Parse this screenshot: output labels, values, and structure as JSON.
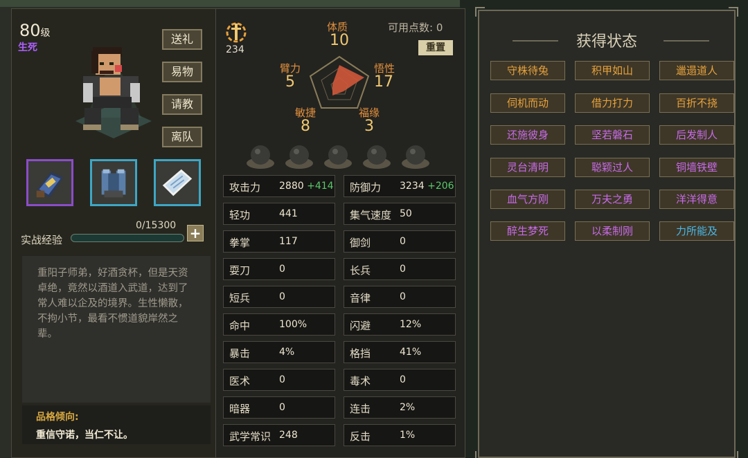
{
  "character": {
    "level_number": "80",
    "level_unit": "级",
    "faction": "生死"
  },
  "actions": [
    "送礼",
    "易物",
    "请教",
    "离队"
  ],
  "equipment": [
    {
      "name": "gauntlet",
      "icon": "gauntlet-icon"
    },
    {
      "name": "armor",
      "icon": "armor-icon"
    },
    {
      "name": "scroll",
      "icon": "scroll-icon"
    }
  ],
  "experience": {
    "label": "实战经验",
    "value": "0/15300",
    "progress": 0,
    "add": "+"
  },
  "description": "重阳子师弟，好酒贪杯，但是天资卓绝，竟然以酒道入武道，达到了常人难以企及的境界。生性懒散，不拘小节，最看不惯道貌岸然之辈。",
  "trait": {
    "title": "品格倾向:",
    "text": "重信守诺，当仁不让。"
  },
  "points": {
    "value": "234",
    "available_label": "可用点数:",
    "available_value": "0",
    "reset": "重置"
  },
  "attributes": {
    "constitution": {
      "name": "体质",
      "value": "10"
    },
    "strength": {
      "name": "臂力",
      "value": "5"
    },
    "insight": {
      "name": "悟性",
      "value": "17"
    },
    "agility": {
      "name": "敏捷",
      "value": "8"
    },
    "fortune": {
      "name": "福缘",
      "value": "3"
    }
  },
  "stats": [
    {
      "label": "攻击力",
      "value": "2880",
      "bonus": "+414"
    },
    {
      "label": "防御力",
      "value": "3234",
      "bonus": "+206"
    },
    {
      "label": "轻功",
      "value": "441",
      "bonus": ""
    },
    {
      "label": "集气速度",
      "value": "50",
      "bonus": ""
    },
    {
      "label": "拳掌",
      "value": "117",
      "bonus": ""
    },
    {
      "label": "御剑",
      "value": "0",
      "bonus": ""
    },
    {
      "label": "耍刀",
      "value": "0",
      "bonus": ""
    },
    {
      "label": "长兵",
      "value": "0",
      "bonus": ""
    },
    {
      "label": "短兵",
      "value": "0",
      "bonus": ""
    },
    {
      "label": "音律",
      "value": "0",
      "bonus": ""
    },
    {
      "label": "命中",
      "value": "100%",
      "bonus": ""
    },
    {
      "label": "闪避",
      "value": "12%",
      "bonus": ""
    },
    {
      "label": "暴击",
      "value": "4%",
      "bonus": ""
    },
    {
      "label": "格挡",
      "value": "41%",
      "bonus": ""
    },
    {
      "label": "医术",
      "value": "0",
      "bonus": ""
    },
    {
      "label": "毒术",
      "value": "0",
      "bonus": ""
    },
    {
      "label": "暗器",
      "value": "0",
      "bonus": ""
    },
    {
      "label": "连击",
      "value": "2%",
      "bonus": ""
    },
    {
      "label": "武学常识",
      "value": "248",
      "bonus": ""
    },
    {
      "label": "反击",
      "value": "1%",
      "bonus": ""
    }
  ],
  "status": {
    "title": "获得状态",
    "items": [
      {
        "label": "守株待兔",
        "color": "#e8a23a"
      },
      {
        "label": "积甲如山",
        "color": "#e8a23a"
      },
      {
        "label": "邋遢道人",
        "color": "#e8a23a"
      },
      {
        "label": "伺机而动",
        "color": "#e8a23a"
      },
      {
        "label": "借力打力",
        "color": "#e8a23a"
      },
      {
        "label": "百折不挠",
        "color": "#e8a23a"
      },
      {
        "label": "还施彼身",
        "color": "#c86ae8"
      },
      {
        "label": "坚若磐石",
        "color": "#c86ae8"
      },
      {
        "label": "后发制人",
        "color": "#c86ae8"
      },
      {
        "label": "灵台清明",
        "color": "#c86ae8"
      },
      {
        "label": "聪颖过人",
        "color": "#c86ae8"
      },
      {
        "label": "铜墙铁壁",
        "color": "#c86ae8"
      },
      {
        "label": "血气方刚",
        "color": "#c86ae8"
      },
      {
        "label": "万夫之勇",
        "color": "#c86ae8"
      },
      {
        "label": "洋洋得意",
        "color": "#c86ae8"
      },
      {
        "label": "醉生梦死",
        "color": "#c86ae8"
      },
      {
        "label": "以柔制刚",
        "color": "#c86ae8"
      },
      {
        "label": "力所能及",
        "color": "#4ab8e8"
      }
    ]
  }
}
